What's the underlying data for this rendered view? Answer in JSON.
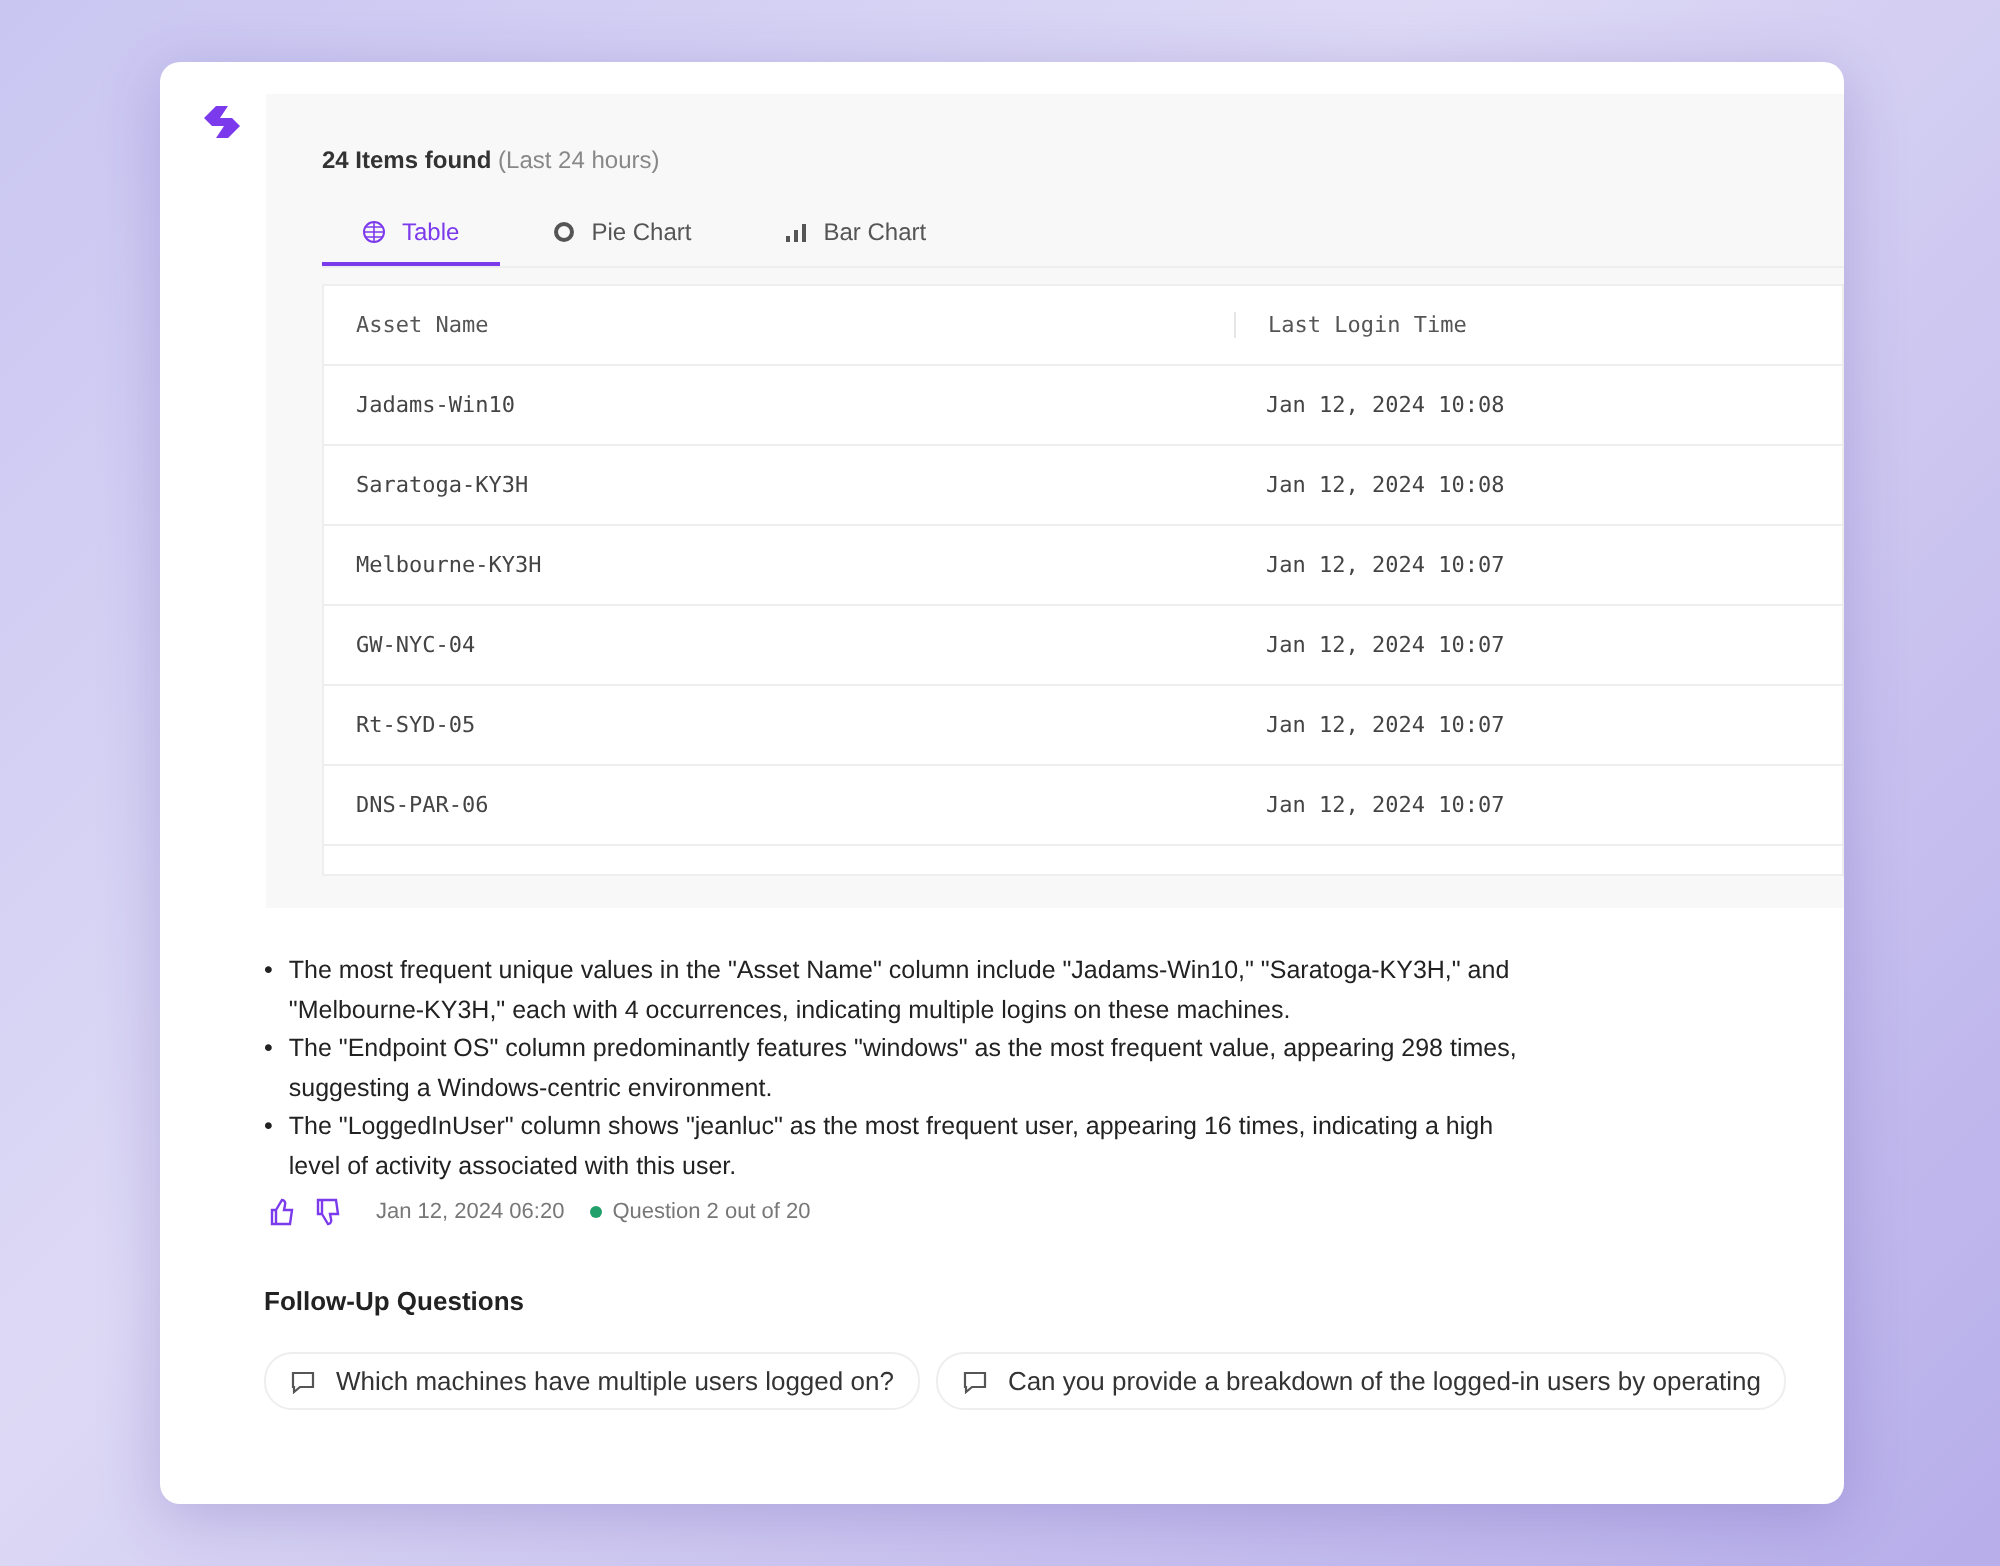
{
  "result": {
    "count": "24 Items found",
    "range": "(Last 24 hours)"
  },
  "tabs": [
    {
      "kind": "table",
      "label": "Table",
      "selected": true
    },
    {
      "kind": "pie",
      "label": "Pie Chart",
      "selected": false
    },
    {
      "kind": "bar",
      "label": "Bar Chart",
      "selected": false
    }
  ],
  "table": {
    "columns": [
      "Asset Name",
      "Last Login Time"
    ],
    "rows": [
      [
        "Jadams-Win10",
        "Jan 12, 2024 10:08"
      ],
      [
        "Saratoga-KY3H",
        "Jan 12, 2024 10:08"
      ],
      [
        "Melbourne-KY3H",
        "Jan 12, 2024 10:07"
      ],
      [
        "GW-NYC-04",
        "Jan 12, 2024 10:07"
      ],
      [
        "Rt-SYD-05",
        "Jan 12, 2024 10:07"
      ],
      [
        "DNS-PAR-06",
        "Jan 12, 2024 10:07"
      ]
    ]
  },
  "summary_marker": "•",
  "summary": [
    "The most frequent unique values in the \"Asset Name\" column include \"Jadams-Win10,\" \"Saratoga-KY3H,\" and \"Melbourne-KY3H,\" each with 4 occurrences, indicating multiple logins on these machines.",
    "The \"Endpoint OS\" column predominantly features \"windows\" as the most frequent value, appearing 298 times, suggesting a Windows-centric environment.",
    "The \"LoggedInUser\" column shows \"jeanluc\" as the most frequent user, appearing 16 times, indicating a high level of activity associated with this user."
  ],
  "meta": {
    "timestamp": "Jan 12, 2024 06:20",
    "question": "Question 2 out of 20"
  },
  "follow_up": {
    "title": "Follow-Up Questions",
    "questions": [
      "Which machines have multiple users logged on?",
      "Can you provide a breakdown of the logged-in users by operating"
    ]
  }
}
